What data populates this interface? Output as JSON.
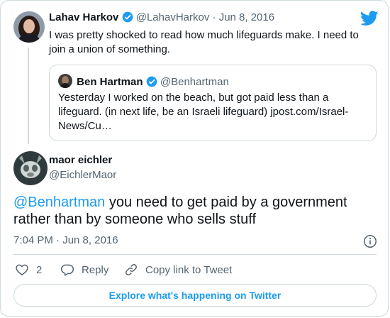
{
  "parent_tweet": {
    "name": "Lahav Harkov",
    "handle": "@LahavHarkov",
    "separator": "·",
    "date": "Jun 8, 2016",
    "text": "I was pretty shocked to read how much lifeguards make. I need to join a union of something."
  },
  "quoted_tweet": {
    "name": "Ben Hartman",
    "handle": "@Benhartman",
    "text": "Yesterday I worked on the beach, but got paid less than a lifeguard. (in next life, be an Israeli lifeguard) jpost.com/Israel-News/Cu…"
  },
  "main_tweet": {
    "name": "maor eichler",
    "handle": "@EichlerMaor",
    "mention": "@Benhartman",
    "text": " you need to get paid by a government rather than by someone who sells stuff",
    "timestamp": "7:04 PM · Jun 8, 2016"
  },
  "actions": {
    "like_count": "2",
    "reply_label": "Reply",
    "copy_label": "Copy link to Tweet"
  },
  "explore_label": "Explore what's happening on Twitter",
  "colors": {
    "accent": "#1d9bf0",
    "verified": "#1d9bf0",
    "border": "#cfd9de",
    "muted": "#536471"
  },
  "icons": [
    "twitter-bird-icon",
    "verified-badge-icon",
    "info-icon",
    "heart-icon",
    "reply-bubble-icon",
    "link-icon"
  ]
}
